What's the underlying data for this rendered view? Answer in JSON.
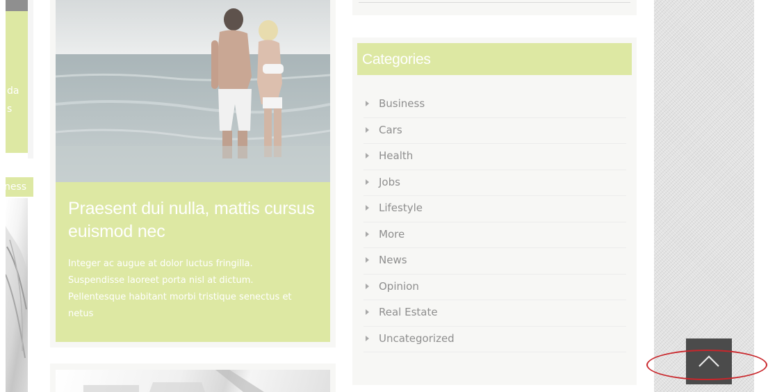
{
  "left_column": {
    "top_card_text": "da\ns",
    "category_label": "ness"
  },
  "featured_post": {
    "title": "Praesent dui nulla, mattis cursus euismod nec",
    "excerpt": "Integer ac augue at dolor luctus fringilla. Suspendisse laoreet porta nisl at dictum. Pellentesque habitant morbi tristique senectus et netus"
  },
  "categories_widget": {
    "title": "Categories",
    "items": [
      {
        "label": "Business"
      },
      {
        "label": "Cars"
      },
      {
        "label": "Health"
      },
      {
        "label": "Jobs"
      },
      {
        "label": "Lifestyle"
      },
      {
        "label": "More"
      },
      {
        "label": "News"
      },
      {
        "label": "Opinion"
      },
      {
        "label": "Real Estate"
      },
      {
        "label": "Uncategorized"
      }
    ]
  },
  "back_to_top": {
    "icon": "chevron-up-icon"
  },
  "colors": {
    "accent": "#dde8a3",
    "button": "#4b4b4b",
    "annotation": "#c9262b"
  }
}
